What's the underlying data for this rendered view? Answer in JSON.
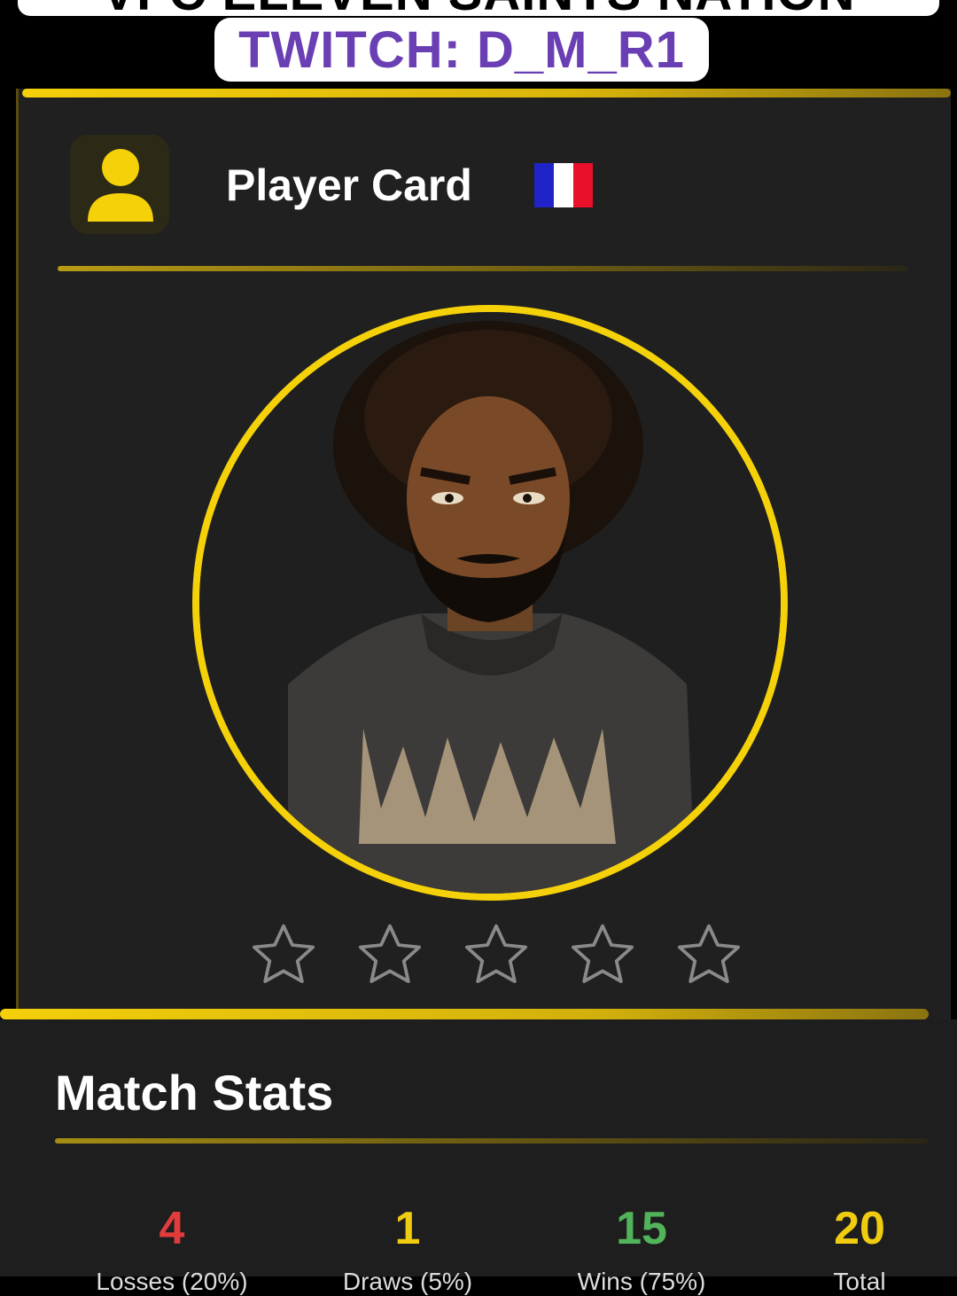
{
  "overlay": {
    "banner_text": "VFC ELEVEN SAINTS NATION",
    "twitch_text": "TWITCH: D_M_R1"
  },
  "card": {
    "title": "Player Card",
    "flag": "france-flag",
    "avatar_icon": "user-icon",
    "rating": {
      "filled": 0,
      "max": 5
    }
  },
  "stats": {
    "title": "Match Stats",
    "items": [
      {
        "value": "4",
        "label": "Losses (20%)",
        "color": "#e23c3c"
      },
      {
        "value": "1",
        "label": "Draws (5%)",
        "color": "#f0cc10"
      },
      {
        "value": "15",
        "label": "Wins (75%)",
        "color": "#52b45a"
      },
      {
        "value": "20",
        "label": "Total",
        "color": "#f0cc10"
      }
    ]
  },
  "colors": {
    "accent": "#f5d10a",
    "twitch": "#6a3fb4",
    "card_bg": "#202020"
  }
}
